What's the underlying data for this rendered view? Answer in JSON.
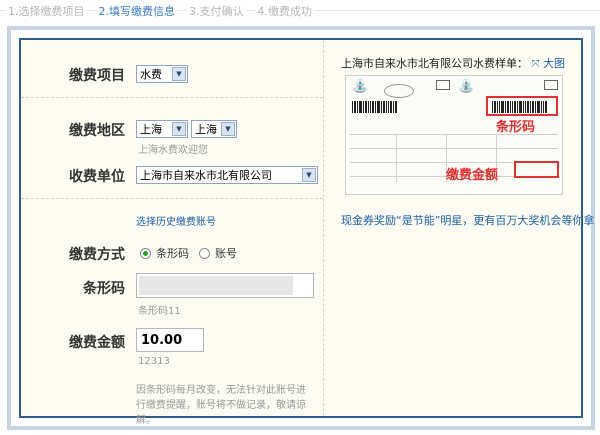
{
  "steps": [
    {
      "label": "1.选择缴费项目",
      "active": false
    },
    {
      "label": "2.填写缴费信息",
      "active": true
    },
    {
      "label": "3.支付确认",
      "active": false
    },
    {
      "label": "4.缴费成功",
      "active": false
    }
  ],
  "form": {
    "item_label": "缴费项目",
    "item_value": "水费",
    "region_label": "缴费地区",
    "region_province": "上海",
    "region_city": "上海",
    "region_hint": "上海水费欢迎您",
    "unit_label": "收费单位",
    "unit_value": "上海市自来水市北有限公司",
    "history_link": "选择历史缴费账号",
    "method_label": "缴费方式",
    "method_options": [
      "条形码",
      "账号"
    ],
    "method_selected": "条形码",
    "barcode_label": "条形码",
    "barcode_hint": "条形码11",
    "amount_label": "缴费金额",
    "amount_value": "10.00",
    "amount_hint": "12313",
    "note": "因条形码每月改变，无法针对此账号进行缴费提醒，账号将不做记录，敬请谅解。"
  },
  "sample": {
    "title": "上海市自来水市北有限公司水费样单：",
    "big_label": "大图",
    "barcode_caption": "条形码",
    "amount_caption": "缴费金额",
    "promo": "现金券奖励“是节能”明星，更有百万大奖机会等你拿"
  },
  "colors": {
    "accent": "#2f5d8e",
    "link": "#1d5fa8",
    "highlight": "#e03030"
  }
}
